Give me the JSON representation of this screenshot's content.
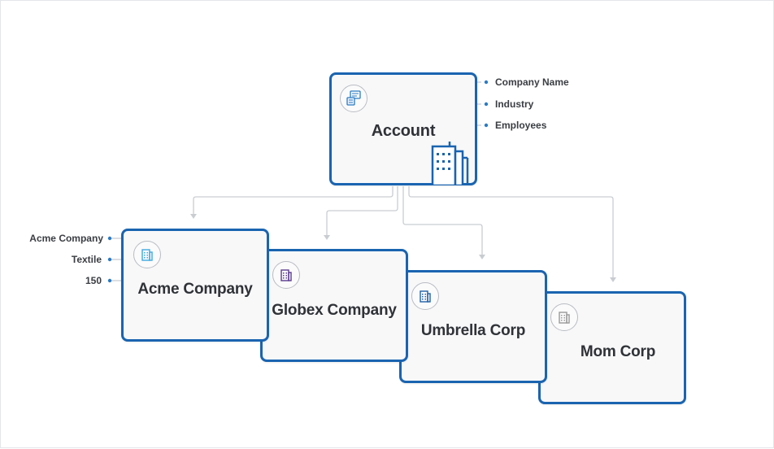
{
  "account": {
    "title": "Account",
    "fields": [
      "Company Name",
      "Industry",
      "Employees"
    ]
  },
  "records": [
    {
      "title": "Acme Company",
      "icon": "building-icon",
      "icon_color": "#3fa9e0",
      "values": [
        "Acme Company",
        "Textile",
        "150"
      ]
    },
    {
      "title": "Globex Company",
      "icon": "building-icon",
      "icon_color": "#5b3a8e"
    },
    {
      "title": "Umbrella Corp",
      "icon": "building-icon",
      "icon_color": "#1f5fa8"
    },
    {
      "title": "Mom Corp",
      "icon": "building-icon",
      "icon_color": "#9a9a9a"
    }
  ],
  "colors": {
    "card_border": "#1a64b0",
    "connector": "#c9cdd2",
    "field_dot": "#2b7bc4"
  }
}
